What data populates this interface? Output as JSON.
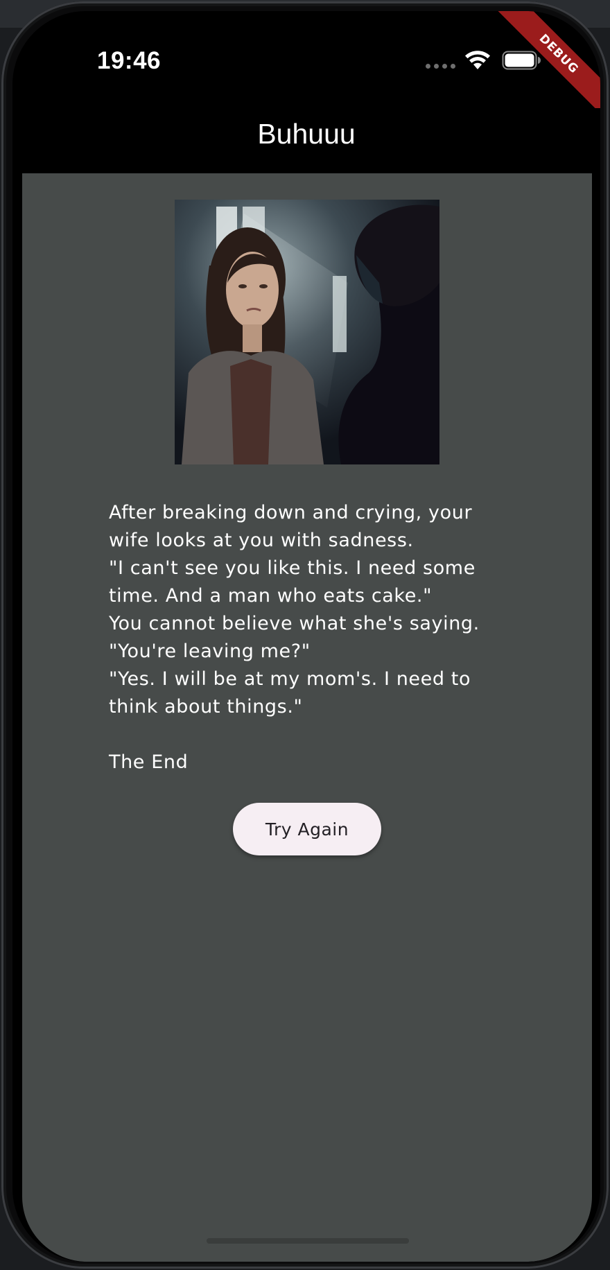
{
  "status_bar": {
    "time": "19:46"
  },
  "debug_banner": "DEBUG",
  "app_bar": {
    "title": "Buhuuu"
  },
  "story": {
    "image_icon": "illustration-sad-woman-and-man",
    "text": "After breaking down and crying, your wife looks at you with sadness.\n\"I can't see you like this. I need some time. And a man who eats cake.\"\nYou cannot believe what she's saying.\n\"You're leaving me?\"\n\"Yes. I will be at my mom's. I need to think about things.\"\n\nThe End"
  },
  "actions": {
    "try_again_label": "Try Again"
  },
  "colors": {
    "app_bar_bg": "#000000",
    "body_bg": "#474b4a",
    "button_bg": "#f6eef3",
    "debug_banner": "#9b1c1c"
  }
}
